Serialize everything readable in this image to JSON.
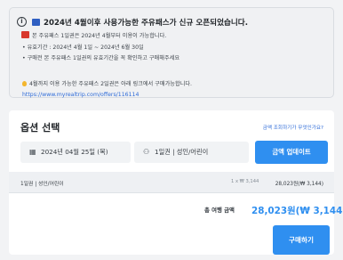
{
  "notice": {
    "icon": "info-icon",
    "title": "2024년 4월이후 사용가능한 주유패스가 신규 오픈되었습니다.",
    "line1": "본 주유패스 1일권은 2024년 4월부터 이용이 가능합니다.",
    "line2": "• 유효기간 : 2024년 4월 1일 ~ 2024년 6월 30일",
    "line3": "• 구매전 본 주유패스 1일권의 유효기간을 꼭 확인하고 구매해주세요",
    "line4": "4월까지 이용 가능한 주유패스 2일권은 아래 링크에서 구매가능합니다.",
    "link": "https://www.myrealtrip.com/offers/116114"
  },
  "options": {
    "title": "옵션 선택",
    "help_link": "금액 조회하기가 무엇인가요?",
    "date": "2024년 04월 25일 (목)",
    "quantity": "1일권 | 성인/어린이",
    "update_button": "금액 업데이트"
  },
  "summary": {
    "name": "1일권 | 성인/어린이",
    "calc": "1 x ₩ 3,144",
    "price": "28,023원(₩ 3,144)"
  },
  "total": {
    "label": "총 여행 금액",
    "value": "28,023원(₩ 3,144)"
  },
  "buy_button": "구매하기",
  "colors": {
    "accent": "#2f8ff0",
    "link": "#2e6bd8"
  }
}
